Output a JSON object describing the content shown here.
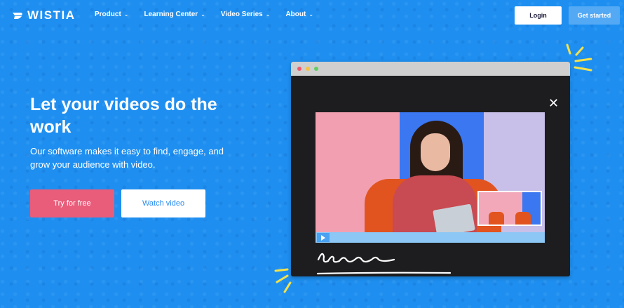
{
  "nav": {
    "logo_text": "WISTIA",
    "menu": [
      {
        "label": "Product"
      },
      {
        "label": "Learning Center"
      },
      {
        "label": "Video Series"
      },
      {
        "label": "About"
      }
    ],
    "login_label": "Login",
    "get_started_label": "Get started"
  },
  "hero": {
    "title": "Let your videos do the work",
    "subtitle": "Our software makes it easy to find, engage, and grow your audience with video.",
    "try_label": "Try for free",
    "watch_label": "Watch video"
  },
  "colors": {
    "background": "#1e8ff0",
    "accent_pink": "#e95c7a",
    "button_blue": "#54a9f5"
  },
  "icons": [
    "wistia-logo-icon",
    "chevron-down-icon",
    "close-icon",
    "play-icon"
  ]
}
